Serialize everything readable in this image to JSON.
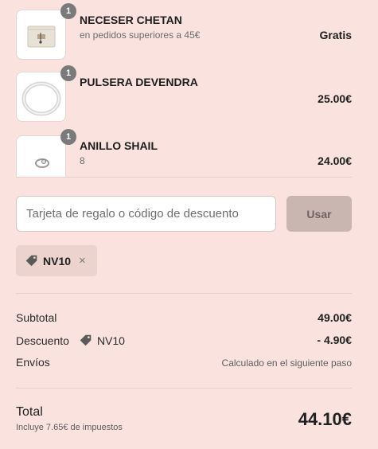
{
  "cart_items": [
    {
      "quantity": "1",
      "name": "NECESER CHETAN",
      "subtitle": "en pedidos superiores a 45€",
      "price": "Gratis"
    },
    {
      "quantity": "1",
      "name": "PULSERA DEVENDRA",
      "subtitle": "",
      "price": "25.00€"
    },
    {
      "quantity": "1",
      "name": "ANILLO SHAIL",
      "subtitle": "8",
      "price": "24.00€"
    }
  ],
  "discount": {
    "placeholder": "Tarjeta de regalo o código de descuento",
    "value": "",
    "apply_label": "Usar",
    "applied_code": "NV10",
    "remove_symbol": "×"
  },
  "summary": {
    "subtotal_label": "Subtotal",
    "subtotal_value": "49.00€",
    "discount_label": "Descuento",
    "discount_code": "NV10",
    "discount_value": "- 4.90€",
    "shipping_label": "Envíos",
    "shipping_value": "Calculado en el siguiente paso",
    "total_label": "Total",
    "total_note": "Incluye 7.65€ de impuestos",
    "total_value": "44.10€"
  },
  "colors": {
    "background": "#fae3de",
    "badge": "#7a7a7a",
    "apply_button": "#c9b6b0",
    "code_tag": "#ecd3cd"
  }
}
